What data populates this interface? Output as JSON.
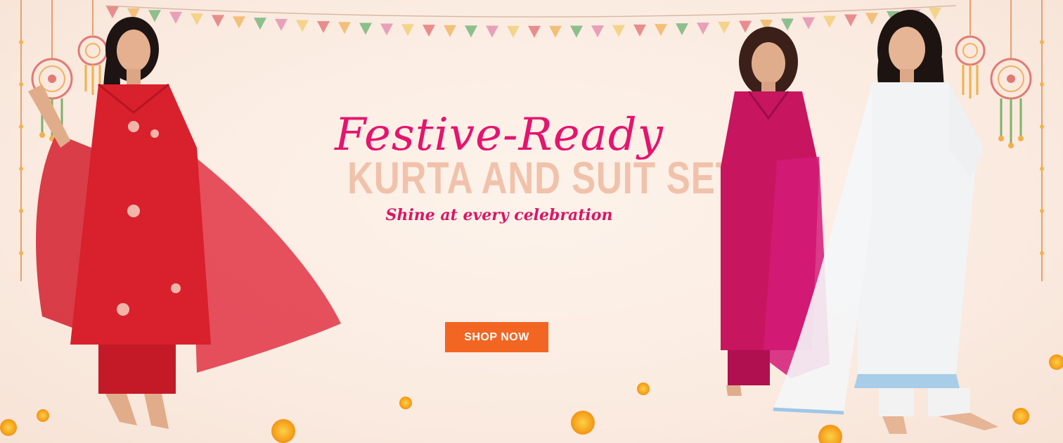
{
  "banner": {
    "headline_script": "Festive-Ready",
    "headline_main": "KURTA AND SUIT SETS",
    "tagline": "Shine at every celebration",
    "cta_label": "SHOP NOW"
  },
  "colors": {
    "background": "#fbeee4",
    "script_pink": "#e5146f",
    "main_peach": "#f1c2ab",
    "tagline_pink": "#d91766",
    "cta_orange": "#f26522",
    "marigold": "#f7a21b"
  },
  "decorations": {
    "icons": [
      "bunting-flags",
      "dreamcatcher-hanging",
      "marigold-flower"
    ]
  },
  "models": [
    {
      "outfit": "red anarkali suit with dupatta"
    },
    {
      "outfit": "magenta kurta set with dupatta"
    },
    {
      "outfit": "white kurta set with blue lace trim"
    }
  ]
}
